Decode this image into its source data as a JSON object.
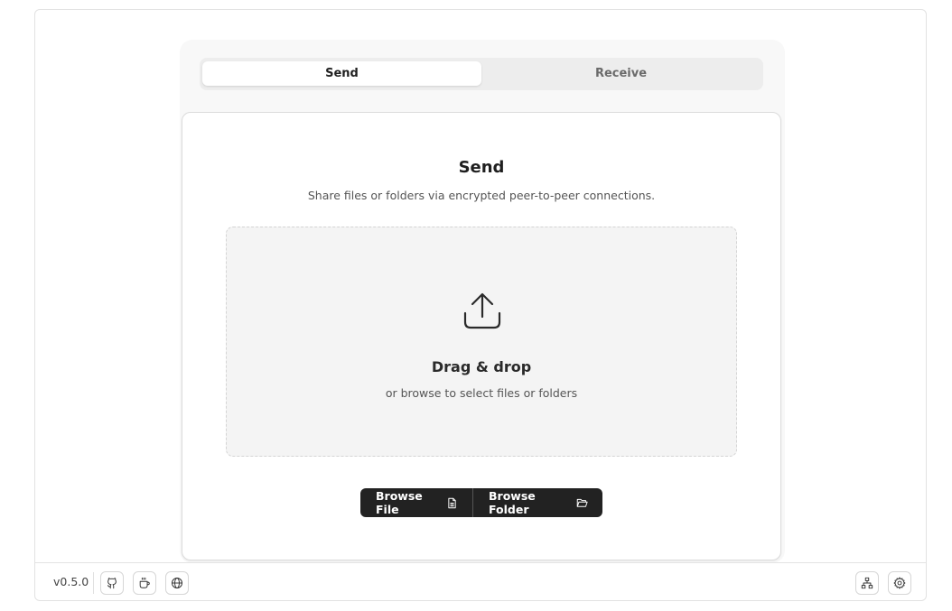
{
  "tabs": [
    {
      "label": "Send",
      "active": true
    },
    {
      "label": "Receive",
      "active": false
    }
  ],
  "send": {
    "title": "Send",
    "subtitle": "Share files or folders via encrypted peer-to-peer connections."
  },
  "dropzone": {
    "icon": "upload-icon",
    "title": "Drag & drop",
    "subtitle": "or browse to select files or folders"
  },
  "buttons": {
    "browse_file": "Browse File",
    "browse_folder": "Browse Folder"
  },
  "footer": {
    "version": "v0.5.0",
    "left_icons": [
      "github-icon",
      "coffee-icon",
      "globe-icon"
    ],
    "right_icons": [
      "network-icon",
      "gear-icon"
    ]
  },
  "colors": {
    "button_bg": "#222222",
    "panel_bg": "#f8f8f8",
    "tab_track": "#ededed"
  }
}
